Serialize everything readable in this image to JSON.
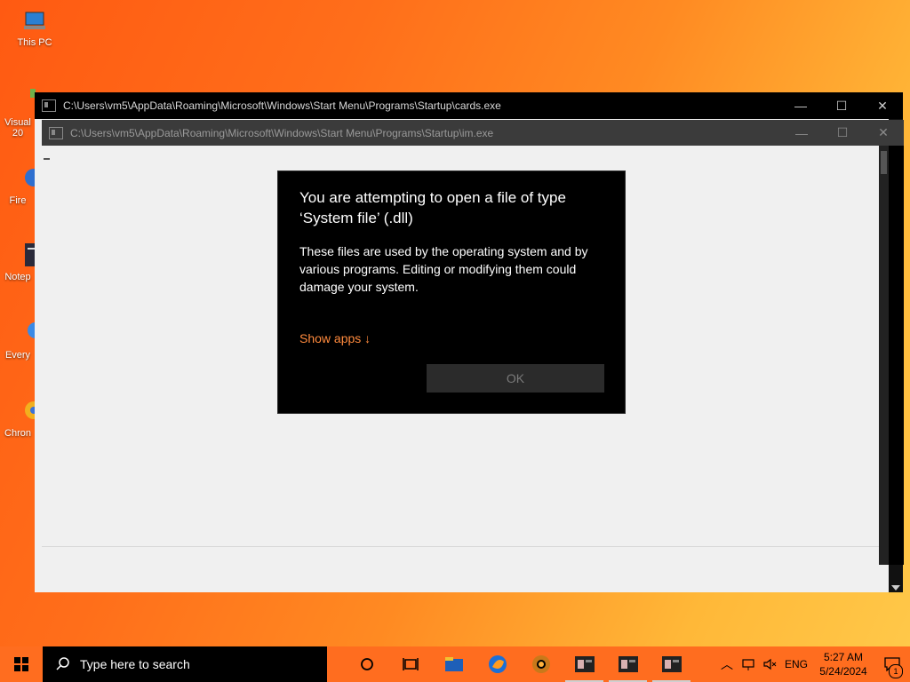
{
  "desktop": {
    "icons": [
      {
        "label": "This PC"
      },
      {
        "label": "Visual 20"
      },
      {
        "label": "Fire"
      },
      {
        "label": "Notep"
      },
      {
        "label": "Every"
      },
      {
        "label": "Chron"
      }
    ]
  },
  "outer_window": {
    "title": "C:\\Users\\vm5\\AppData\\Roaming\\Microsoft\\Windows\\Start Menu\\Programs\\Startup\\cards.exe",
    "min_glyph": "—",
    "max_glyph": "☐",
    "close_glyph": "✕"
  },
  "inner_window": {
    "title": "C:\\Users\\vm5\\AppData\\Roaming\\Microsoft\\Windows\\Start Menu\\Programs\\Startup\\im.exe",
    "min_glyph": "—",
    "max_glyph": "☐",
    "close_glyph": "✕"
  },
  "dialog": {
    "title": "You are attempting to open a file of type ‘System file’ (.dll)",
    "message": "These files are used by the operating system and by various programs. Editing or modifying them could damage your system.",
    "show_apps": "Show apps ↓",
    "ok_label": "OK",
    "link_color": "#ff8a3d"
  },
  "taskbar": {
    "search_placeholder": "Type here to search",
    "language": "ENG",
    "time": "5:27 AM",
    "date": "5/24/2024",
    "notification_count": "1",
    "apps": [
      "cortana-icon",
      "task-view-icon",
      "file-explorer-icon",
      "firefox-icon",
      "chrome-icon",
      "terminal-icon",
      "terminal-icon",
      "terminal-icon"
    ]
  },
  "colors": {
    "taskbar": "#ff6d1f",
    "dialog_bg": "#000000",
    "accent": "#ff8a3d"
  }
}
